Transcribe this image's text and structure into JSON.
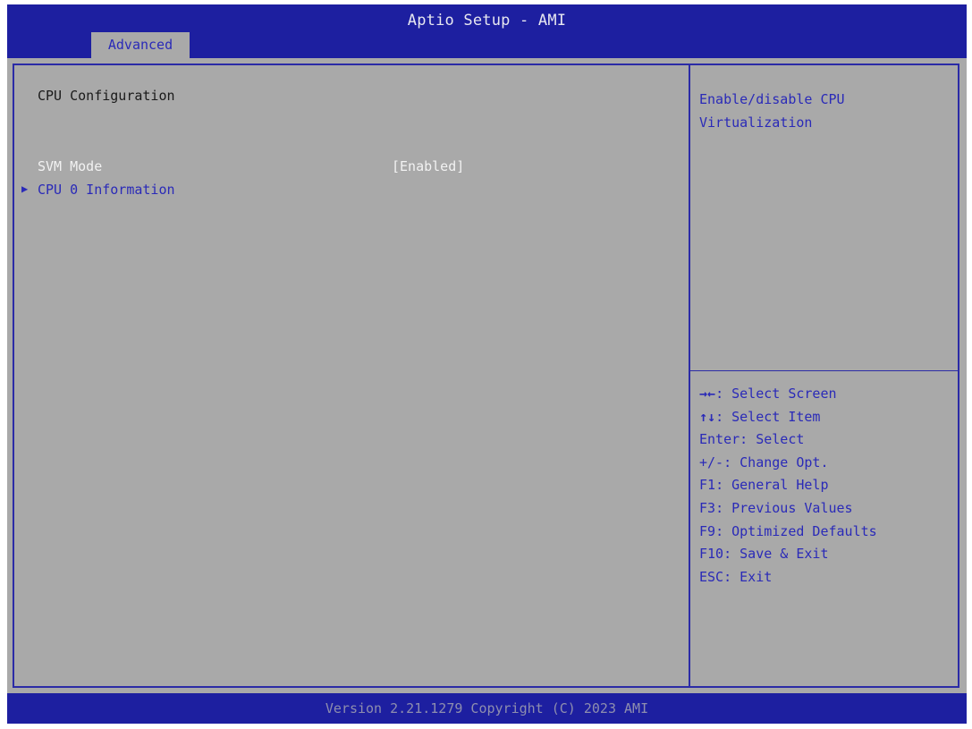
{
  "header": {
    "title": "Aptio Setup - AMI",
    "tabs": [
      {
        "label": "Advanced",
        "active": true
      }
    ]
  },
  "main": {
    "section_title": "CPU Configuration",
    "settings": [
      {
        "label": "SVM Mode",
        "value": "[Enabled]",
        "selected": true
      }
    ],
    "submenus": [
      {
        "label": "CPU 0 Information",
        "arrow": "▶"
      }
    ]
  },
  "help": {
    "lines": [
      "Enable/disable CPU",
      "Virtualization"
    ]
  },
  "keys": [
    {
      "key": "→←",
      "action": ": Select Screen"
    },
    {
      "key": "↑↓",
      "action": ": Select Item"
    },
    {
      "key": "Enter",
      "action": ": Select"
    },
    {
      "key": "+/-",
      "action": ": Change Opt."
    },
    {
      "key": "F1",
      "action": ": General Help"
    },
    {
      "key": "F3",
      "action": ": Previous Values"
    },
    {
      "key": "F9",
      "action": ": Optimized Defaults"
    },
    {
      "key": "F10",
      "action": ": Save & Exit"
    },
    {
      "key": "ESC",
      "action": ": Exit"
    }
  ],
  "footer": {
    "version": "Version 2.21.1279 Copyright (C) 2023 AMI"
  },
  "colors": {
    "bar_blue": "#1d1fa0",
    "panel_gray": "#a9a9a9",
    "text_blue": "#2a2ab8",
    "selected_white": "#f2f2f2"
  }
}
